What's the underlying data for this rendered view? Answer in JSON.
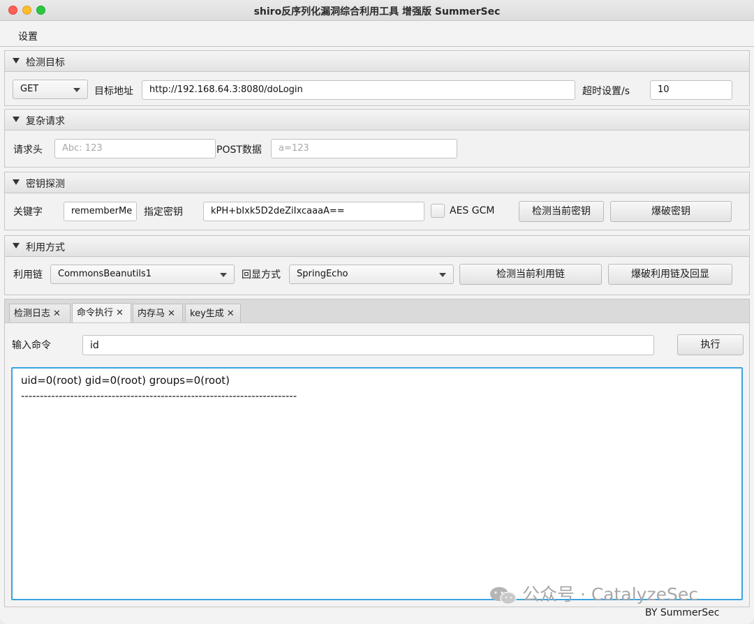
{
  "window": {
    "title": "shiro反序列化漏洞综合利用工具 增强版 SummerSec"
  },
  "menu": {
    "settings": "设置"
  },
  "target_pane": {
    "title": "检测目标",
    "method": "GET",
    "url_label": "目标地址",
    "url": "http://192.168.64.3:8080/doLogin",
    "timeout_label": "超时设置/s",
    "timeout": "10"
  },
  "complex_pane": {
    "title": "复杂请求",
    "header_label": "请求头",
    "header_placeholder": "Abc: 123",
    "post_label": "POST数据",
    "post_placeholder": "a=123"
  },
  "key_pane": {
    "title": "密钥探测",
    "keyword_label": "关键字",
    "keyword": "rememberMe",
    "key_label": "指定密钥",
    "key": "kPH+bIxk5D2deZiIxcaaaA==",
    "aes_gcm_label": "AES GCM",
    "aes_gcm_checked": false,
    "check_key_button": "检测当前密钥",
    "brute_key_button": "爆破密钥"
  },
  "exploit_pane": {
    "title": "利用方式",
    "chain_label": "利用链",
    "chain": "CommonsBeanutils1",
    "echo_label": "回显方式",
    "echo": "SpringEcho",
    "check_chain_button": "检测当前利用链",
    "brute_chain_button": "爆破利用链及回显"
  },
  "tabs": [
    {
      "label": "检测日志",
      "close": "✕",
      "active": false
    },
    {
      "label": "命令执行",
      "close": "✕",
      "active": true
    },
    {
      "label": "内存马",
      "close": "✕",
      "active": false
    },
    {
      "label": "key生成",
      "close": "✕",
      "active": false
    }
  ],
  "command": {
    "label": "输入命令",
    "value": "id",
    "execute_button": "执行"
  },
  "output": {
    "lines": [
      "uid=0(root) gid=0(root) groups=0(root)",
      "-------------------------------------------------------------------------"
    ]
  },
  "watermark": "公众号 · CatalyzeSec",
  "footer": "BY  SummerSec",
  "colors": {
    "focus_border": "#3ba3e0",
    "close": "#ff5f57",
    "minimize": "#febc2e",
    "maximize": "#28c840"
  }
}
